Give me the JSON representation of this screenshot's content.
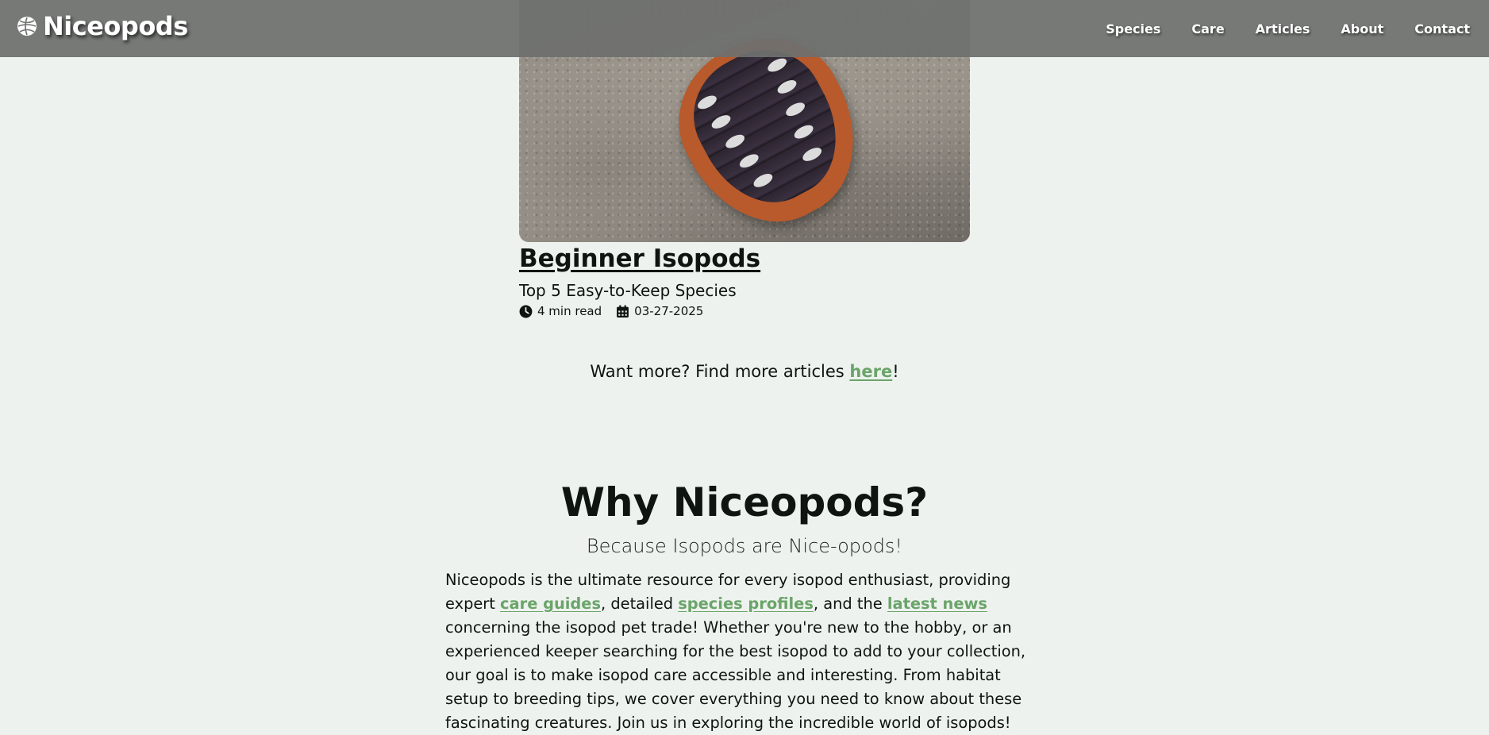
{
  "nav": {
    "brand": "Niceopods",
    "brand_icon": "isopod-logo-icon",
    "links": [
      "Species",
      "Care",
      "Articles",
      "About",
      "Contact"
    ]
  },
  "article": {
    "image_alt": "isopod-photo",
    "title": "Beginner Isopods",
    "subtitle": "Top 5 Easy-to-Keep Species",
    "read_time": "4 min read",
    "read_time_icon": "clock-icon",
    "date": "03-27-2025",
    "date_icon": "calendar-icon"
  },
  "more": {
    "prefix": "Want more? Find more articles ",
    "link": "here",
    "suffix": "!"
  },
  "why": {
    "title": "Why Niceopods?",
    "subtitle": "Because Isopods are Nice-opods!",
    "p1": "Niceopods is the ultimate resource for every isopod enthusiast, providing expert ",
    "link1": "care guides",
    "p2": ", detailed ",
    "link2": "species profiles",
    "p3": ", and the ",
    "link3": "latest news",
    "p4": " concerning the isopod pet trade! Whether you're new to the hobby, or an experienced keeper searching for the best isopod to add to your collection, our goal is to make isopod care accessible and interesting. From habitat setup to breeding tips, we cover everything you need to know about these fascinating creatures. Join us in exploring the incredible world of isopods!"
  },
  "colors": {
    "background": "#eef2ee",
    "nav": "#6e706e",
    "link": "#6aa46a",
    "text": "#0e1410"
  }
}
